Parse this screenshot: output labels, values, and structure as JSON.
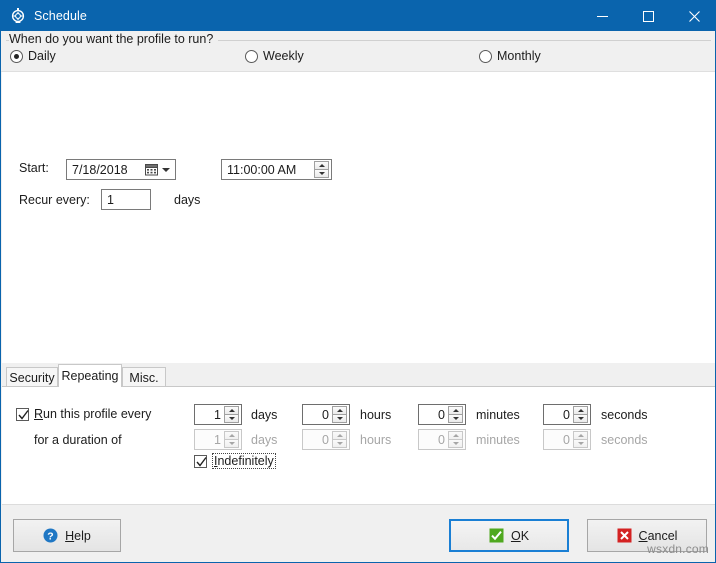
{
  "window": {
    "title": "Schedule",
    "icon": "schedule-clock-icon",
    "accent_color": "#0a64ad",
    "controls": {
      "minimize": "minimize-icon",
      "maximize": "maximize-icon",
      "close": "close-icon"
    }
  },
  "groupbox": {
    "caption": "When do you want the profile to run?",
    "options": [
      {
        "label": "Daily",
        "selected": true
      },
      {
        "label": "Weekly",
        "selected": false
      },
      {
        "label": "Monthly",
        "selected": false
      }
    ]
  },
  "schedule": {
    "start_label": "Start:",
    "start_date": "7/18/2018",
    "start_date_icon": "calendar-icon",
    "start_date_dropdown": "chevron-down-icon",
    "start_time": "11:00:00 AM",
    "recur_label": "Recur every:",
    "recur_value": "1",
    "recur_unit": "days"
  },
  "tabs": [
    {
      "label": "Security",
      "active": false
    },
    {
      "label": "Repeating",
      "active": true
    },
    {
      "label": "Misc.",
      "active": false
    }
  ],
  "repeating": {
    "run_every": {
      "label_prefix": "R",
      "label_rest": "un this profile every",
      "checked": true,
      "days": "1",
      "days_unit": "days",
      "hours": "0",
      "hours_unit": "hours",
      "minutes": "0",
      "minutes_unit": "minutes",
      "seconds": "0",
      "seconds_unit": "seconds"
    },
    "duration": {
      "label": "for a duration of",
      "days": "1",
      "days_unit": "days",
      "hours": "0",
      "hours_unit": "hours",
      "minutes": "0",
      "minutes_unit": "minutes",
      "seconds": "0",
      "seconds_unit": "seconds",
      "disabled": true
    },
    "indefinitely": {
      "label_prefix": "I",
      "label_rest": "ndefinitely",
      "checked": true,
      "focused": true
    }
  },
  "footer": {
    "help": {
      "label_prefix": "H",
      "label_rest": "elp",
      "icon": "help-question-icon"
    },
    "ok": {
      "label_prefix": "O",
      "label_rest": "K",
      "icon": "check-icon",
      "is_default": true
    },
    "cancel": {
      "label_prefix": "C",
      "label_rest": "ancel",
      "icon": "cancel-x-icon"
    }
  },
  "watermark": "wsxdn.com"
}
